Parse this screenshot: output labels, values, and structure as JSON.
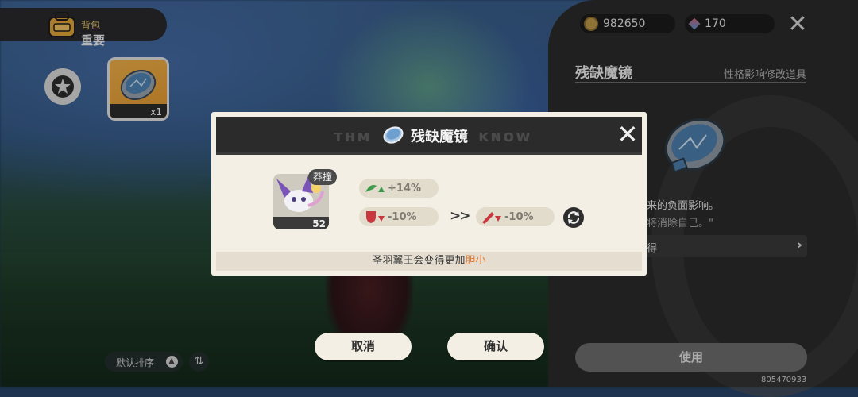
{
  "backpack": {
    "title": "背包",
    "category": "重要"
  },
  "inventory": {
    "item_qty": "x1"
  },
  "sort": {
    "label": "默认排序"
  },
  "currency": {
    "coins": "982650",
    "gems": "170"
  },
  "item_panel": {
    "name": "残缺魔镜",
    "tag": "性格影响修改道具",
    "desc_line1": "来的负面影响。",
    "desc_line2": "将消除自己。\"",
    "obtain_label": "得",
    "use_label": "使用"
  },
  "footer": {
    "uid": "805470933"
  },
  "modal": {
    "title": "残缺魔镜",
    "ghost_left": "ᴛʜᴍ",
    "ghost_right": "ᴋɴᴏᴡ",
    "pet": {
      "name": "莽撞",
      "level": "52"
    },
    "stats": {
      "gain": "+14%",
      "loss_before": "-10%",
      "loss_after": "-10%"
    },
    "arrow": ">>",
    "result_prefix": "圣羽翼王会变得更加",
    "result_trait": "胆小"
  },
  "buttons": {
    "cancel": "取消",
    "confirm": "确认"
  },
  "colors": {
    "highlight": "#e0772f",
    "stat_up": "#3a9c4a",
    "stat_down": "#c9363e"
  }
}
